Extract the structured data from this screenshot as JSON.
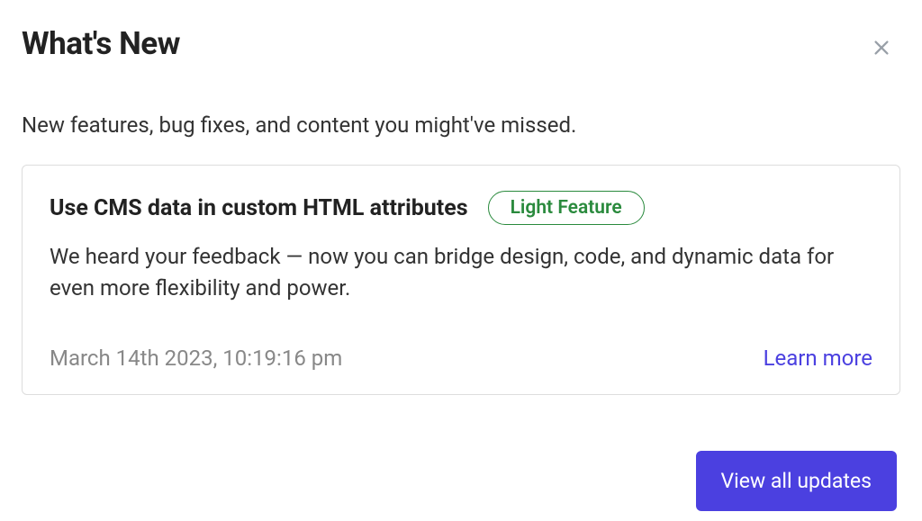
{
  "header": {
    "title": "What's New"
  },
  "subtitle": "New features, bug fixes, and content you might've missed.",
  "card": {
    "title": "Use CMS data in custom HTML attributes",
    "badge": "Light Feature",
    "description": "We heard your feedback — now you can bridge design, code, and dynamic data for even more flexibility and power.",
    "timestamp": "March 14th 2023, 10:19:16 pm",
    "learn_more_label": "Learn more"
  },
  "footer": {
    "view_all_label": "View all updates"
  }
}
